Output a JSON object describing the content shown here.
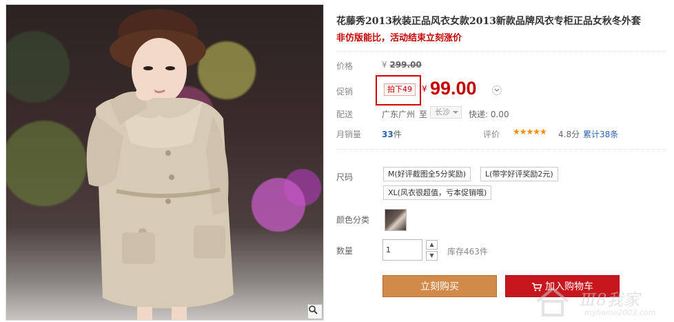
{
  "product": {
    "title": "花藤秀2013秋装正品风衣女款2013新款品牌风衣专柜正品女秋冬外套",
    "subtitle": "非仿版能比，活动结束立刻涨价"
  },
  "price": {
    "label": "价格",
    "currency": "¥",
    "original": "299.00"
  },
  "promo": {
    "label": "促销",
    "tag": "拍下49",
    "currency": "¥",
    "price": "99.00"
  },
  "shipping": {
    "label": "配送",
    "from": "广东广州",
    "to_label": "至",
    "to_city": "长沙",
    "fee": "快递: 0.00"
  },
  "sales": {
    "label": "月销量",
    "count": "33",
    "unit": "件",
    "rating_label": "评价",
    "stars": "★★★★★",
    "score": "4.8分",
    "total": "累计38条"
  },
  "size": {
    "label": "尺码",
    "options": [
      "M(好评截图全5分奖励)",
      "L(带字好评奖励2元)",
      "XL(风衣很超值，亏本促销哦)"
    ]
  },
  "color": {
    "label": "颜色分类"
  },
  "quantity": {
    "label": "数量",
    "value": "1",
    "stock": "库存463件"
  },
  "actions": {
    "buy": "立刻购买",
    "cart": "加入购物车"
  },
  "watermark": {
    "text": "Ⅲ8我家",
    "url": "myhome2003.com"
  },
  "colors": {
    "price_red": "#c40000",
    "buy_orange": "#d28a4b",
    "cart_red": "#c7161d",
    "link_blue": "#2a63b6",
    "star_orange": "#ff8a00"
  }
}
